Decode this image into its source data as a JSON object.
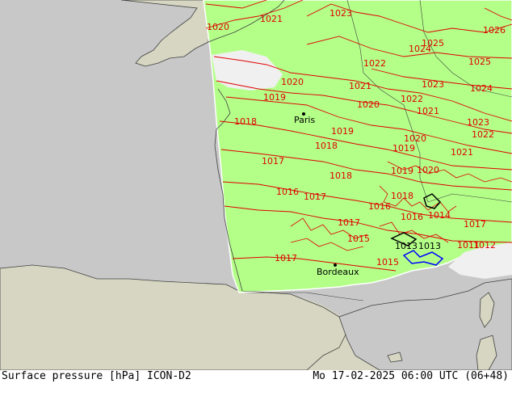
{
  "map": {
    "colors": {
      "sea": "#c8c8c8",
      "land": "#d6d6c2",
      "model_domain": "#b3ff88",
      "isobar": "#e00000",
      "border": "#404040",
      "low_pressure": "#0000ff",
      "nodata": "#f0f0f0"
    },
    "cities": [
      {
        "id": "paris",
        "name": "Paris"
      },
      {
        "id": "bordeaux",
        "name": "Bordeaux"
      }
    ],
    "isobar_labels": [
      "1020",
      "1021",
      "1023",
      "1022",
      "1026",
      "1025",
      "1024",
      "1025",
      "1022",
      "1020",
      "1021",
      "1023",
      "1024",
      "1019",
      "1022",
      "1020",
      "1021",
      "1023",
      "1018",
      "1019",
      "1020",
      "1022",
      "1017",
      "1018",
      "1019",
      "1021",
      "1016",
      "1017",
      "1018",
      "1019",
      "1020",
      "1015",
      "1016",
      "1017",
      "1018",
      "1017",
      "1013",
      "1013",
      "1014",
      "1015",
      "1016",
      "1017",
      "1011",
      "1012"
    ]
  },
  "footer": {
    "title": "Surface pressure [hPa] ICON-D2",
    "datetime": "Mo 17-02-2025 06:00 UTC (06+48)"
  }
}
